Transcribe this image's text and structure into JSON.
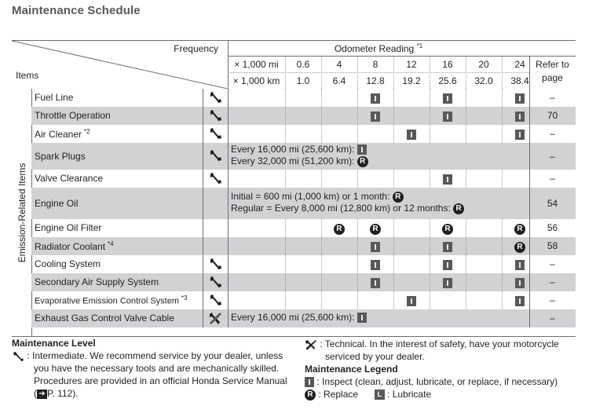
{
  "title": "Maintenance Schedule",
  "header": {
    "frequency_label": "Frequency",
    "items_label": "Items",
    "odometer_label": "Odometer Reading",
    "odometer_note": "*1",
    "mi_unit": "× 1,000 mi",
    "km_unit": "× 1,000 km",
    "mi_values": [
      "0.6",
      "4",
      "8",
      "12",
      "16",
      "20",
      "24"
    ],
    "km_values": [
      "1.0",
      "6.4",
      "12.8",
      "19.2",
      "25.6",
      "32.0",
      "38.4"
    ],
    "refer_line1": "Refer to",
    "refer_line2": "page"
  },
  "side_label": "Emission-Related Items",
  "rows": [
    {
      "name": "Fuel Line",
      "note": "",
      "level": "wrench-icon",
      "marks": [
        "",
        "",
        "I",
        "",
        "I",
        "",
        "I"
      ],
      "ref": "–"
    },
    {
      "name": "Throttle Operation",
      "note": "",
      "level": "wrench-icon",
      "marks": [
        "",
        "",
        "I",
        "",
        "I",
        "",
        "I"
      ],
      "ref": "70"
    },
    {
      "name": "Air Cleaner",
      "note": "*2",
      "level": "wrench-icon",
      "marks": [
        "",
        "",
        "",
        "I",
        "",
        "",
        "I"
      ],
      "ref": "–"
    },
    {
      "name": "Spark Plugs",
      "note": "",
      "level": "wrench-icon",
      "text_lines": [
        "Every 16,000 mi (25,600 km):",
        "Every 32,000 mi (51,200 km):"
      ],
      "text_marks": [
        "I",
        "R"
      ],
      "ref": "–"
    },
    {
      "name": "Valve Clearance",
      "note": "",
      "level": "wrench-icon",
      "marks": [
        "",
        "",
        "",
        "",
        "I",
        "",
        ""
      ],
      "ref": "–"
    },
    {
      "name": "Engine Oil",
      "note": "",
      "level": "",
      "text_lines": [
        "Initial = 600 mi (1,000 km) or 1 month:",
        "Regular = Every 8,000 mi (12,800 km) or 12 months:"
      ],
      "text_marks": [
        "R",
        "R"
      ],
      "ref": "54"
    },
    {
      "name": "Engine Oil Filter",
      "note": "",
      "level": "",
      "marks": [
        "",
        "R",
        "R",
        "",
        "R",
        "",
        "R"
      ],
      "ref": "56"
    },
    {
      "name": "Radiator Coolant",
      "note": "*4",
      "level": "",
      "marks": [
        "",
        "",
        "I",
        "",
        "I",
        "",
        "R"
      ],
      "ref": "58"
    },
    {
      "name": "Cooling System",
      "note": "",
      "level": "wrench-icon",
      "marks": [
        "",
        "",
        "I",
        "",
        "I",
        "",
        "I"
      ],
      "ref": "–"
    },
    {
      "name": "Secondary Air Supply System",
      "note": "",
      "level": "wrench-icon",
      "marks": [
        "",
        "",
        "I",
        "",
        "I",
        "",
        "I"
      ],
      "ref": "–"
    },
    {
      "name": "Evaporative Emission Control System",
      "note": "*3",
      "level": "wrench-icon",
      "marks": [
        "",
        "",
        "",
        "I",
        "",
        "",
        "I"
      ],
      "ref": "–"
    },
    {
      "name": "Exhaust Gas Control Valve Cable",
      "note": "",
      "level": "tools-icon",
      "text_lines": [
        "Every 16,000 mi (25,600 km):"
      ],
      "text_marks": [
        "I"
      ],
      "ref": "–"
    }
  ],
  "legend": {
    "maintenance_level_title": "Maintenance Level",
    "intermediate_line1": ": Intermediate. We recommend service by your dealer, unless",
    "intermediate_line2": "you have the necessary tools and are mechanically skilled.",
    "intermediate_line3": "Procedures are provided in an official Honda Service Manual",
    "intermediate_ref_open": "(",
    "intermediate_ref": "P. 112",
    "intermediate_ref_close": ").",
    "technical_line1": ": Technical. In the interest of safety, have your motorcycle",
    "technical_line2": "serviced by your dealer.",
    "maintenance_legend_title": "Maintenance Legend",
    "inspect_text": ": Inspect (clean, adjust, lubricate, or replace, if necessary)",
    "replace_text": ": Replace",
    "lubricate_text": ": Lubricate",
    "replace_symbol": "R",
    "lubricate_symbol": "L",
    "arrow_symbol": "➔"
  },
  "colors": {
    "shaded_row": "#d1d2d4",
    "mark_fill": "#58595b",
    "title_gray": "#58595b"
  }
}
